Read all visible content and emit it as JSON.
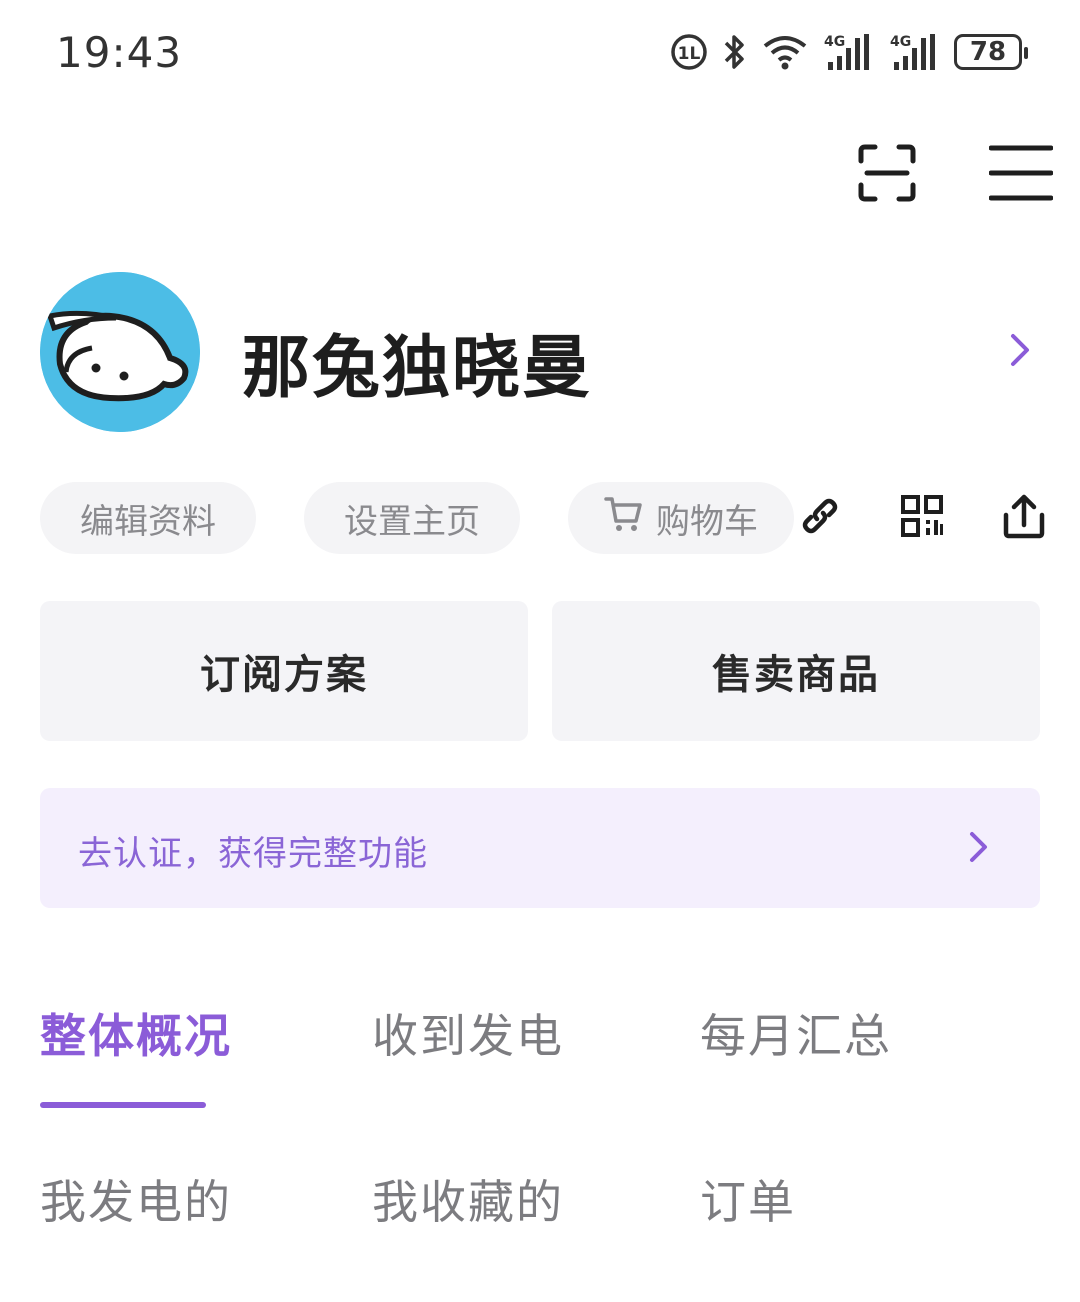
{
  "status_bar": {
    "time": "19:43",
    "battery": "78",
    "network_1": "4G",
    "network_2": "4G",
    "icons": [
      "hd-voice-icon",
      "bluetooth-icon",
      "wifi-icon",
      "signal-4g-icon",
      "signal-4g-icon",
      "battery-icon"
    ]
  },
  "header": {
    "scan_icon": "scan-icon",
    "menu_icon": "menu-icon"
  },
  "profile": {
    "username": "那兔独晓曼",
    "arrow_icon": "chevron-right-icon"
  },
  "quick_actions": {
    "edit_profile": "编辑资料",
    "set_homepage": "设置主页",
    "cart": "购物车",
    "link_icon": "link-icon",
    "qr_icon": "qr-code-icon",
    "share_icon": "share-icon"
  },
  "feature_cards": {
    "subscription_plans": "订阅方案",
    "sell_products": "售卖商品"
  },
  "verify_banner": {
    "text": "去认证，获得完整功能"
  },
  "tabs": [
    {
      "label": "整体概况",
      "active": true
    },
    {
      "label": "收到发电",
      "active": false
    },
    {
      "label": "每月汇总",
      "active": false
    }
  ],
  "links": [
    {
      "label": "我发电的"
    },
    {
      "label": "我收藏的"
    },
    {
      "label": "订单"
    }
  ],
  "colors": {
    "accent": "#8b5cd8",
    "banner_bg": "#f4effd",
    "card_bg": "#f4f4f7",
    "avatar_bg": "#4cbde6"
  }
}
